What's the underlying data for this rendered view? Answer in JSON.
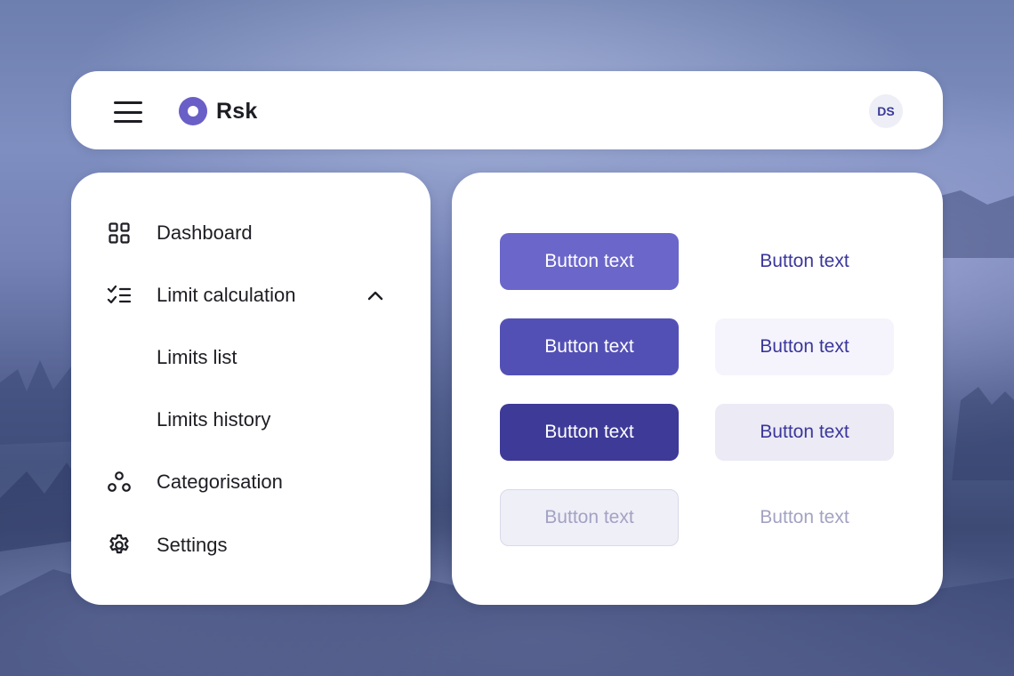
{
  "header": {
    "brand": "Rsk",
    "avatar_initials": "DS"
  },
  "sidebar": {
    "items": [
      {
        "label": "Dashboard",
        "icon": "grid-icon"
      },
      {
        "label": "Limit calculation",
        "icon": "checklist-icon",
        "expanded": true,
        "children": [
          {
            "label": "Limits list"
          },
          {
            "label": "Limits history"
          }
        ]
      },
      {
        "label": "Categorisation",
        "icon": "three-circles-icon"
      },
      {
        "label": "Settings",
        "icon": "gear-icon"
      }
    ]
  },
  "buttons": {
    "primary": [
      {
        "label": "Button text",
        "state": "default"
      },
      {
        "label": "Button text",
        "state": "hover"
      },
      {
        "label": "Button text",
        "state": "pressed"
      },
      {
        "label": "Button text",
        "state": "disabled"
      }
    ],
    "ghost": [
      {
        "label": "Button text",
        "state": "default"
      },
      {
        "label": "Button text",
        "state": "hover"
      },
      {
        "label": "Button text",
        "state": "pressed"
      },
      {
        "label": "Button text",
        "state": "disabled"
      }
    ]
  },
  "colors": {
    "brand": "#6a5fc7",
    "primary_default": "#6b66c9",
    "primary_hover": "#5350b5",
    "primary_pressed": "#3e3a98",
    "ghost_text": "#3a379a",
    "disabled_text": "#a3a2c3"
  }
}
